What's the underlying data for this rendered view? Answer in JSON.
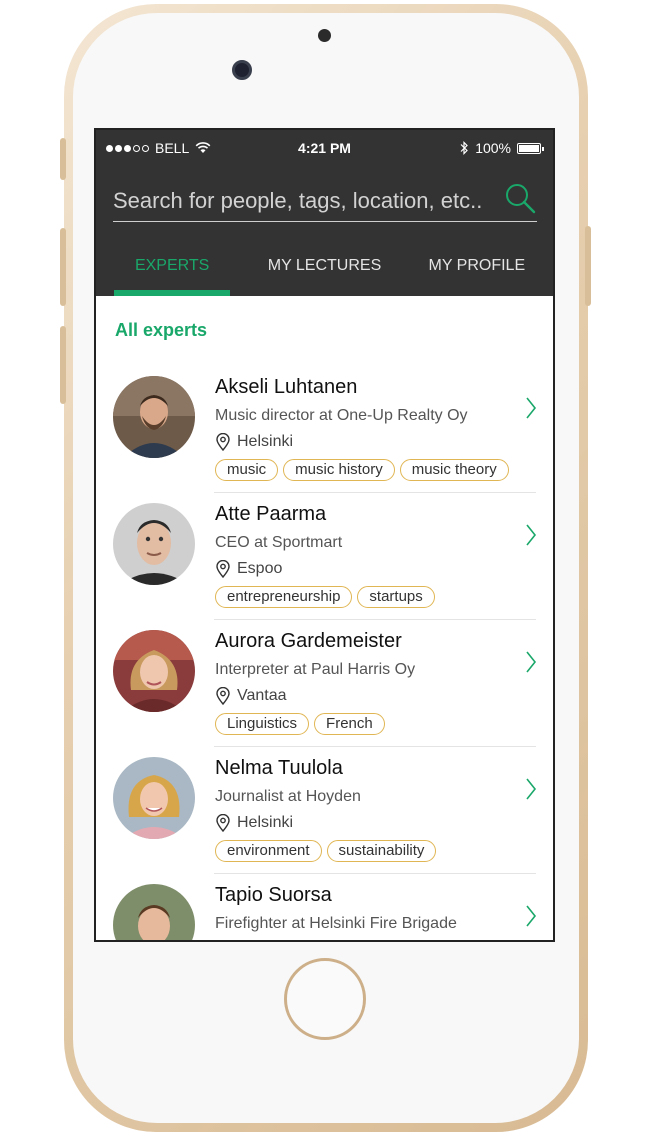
{
  "status_bar": {
    "carrier": "BELL",
    "time": "4:21 PM",
    "battery": "100%"
  },
  "search": {
    "placeholder": "Search for people, tags, location, etc.."
  },
  "tabs": [
    {
      "label": "EXPERTS",
      "active": true
    },
    {
      "label": "MY LECTURES",
      "active": false
    },
    {
      "label": "MY PROFILE",
      "active": false
    }
  ],
  "section_title": "All experts",
  "experts": [
    {
      "name": "Akseli Luhtanen",
      "title": "Music director at One-Up Realty Oy",
      "location": "Helsinki",
      "tags": [
        "music",
        "music history",
        "music theory"
      ]
    },
    {
      "name": "Atte Paarma",
      "title": "CEO at Sportmart",
      "location": "Espoo",
      "tags": [
        "entrepreneurship",
        "startups"
      ]
    },
    {
      "name": "Aurora Gardemeister",
      "title": "Interpreter at Paul Harris Oy",
      "location": "Vantaa",
      "tags": [
        "Linguistics",
        "French"
      ]
    },
    {
      "name": "Nelma Tuulola",
      "title": "Journalist at Hoyden",
      "location": "Helsinki",
      "tags": [
        "environment",
        "sustainability"
      ]
    },
    {
      "name": "Tapio Suorsa",
      "title": "Firefighter at Helsinki Fire Brigade",
      "location": "",
      "tags": []
    }
  ],
  "colors": {
    "accent": "#1aa76a",
    "tag_border": "#e0b654",
    "header_bg": "#333333"
  },
  "icons": {
    "search": "search-icon",
    "location": "pin-icon",
    "chevron": "chevron-right-icon"
  }
}
